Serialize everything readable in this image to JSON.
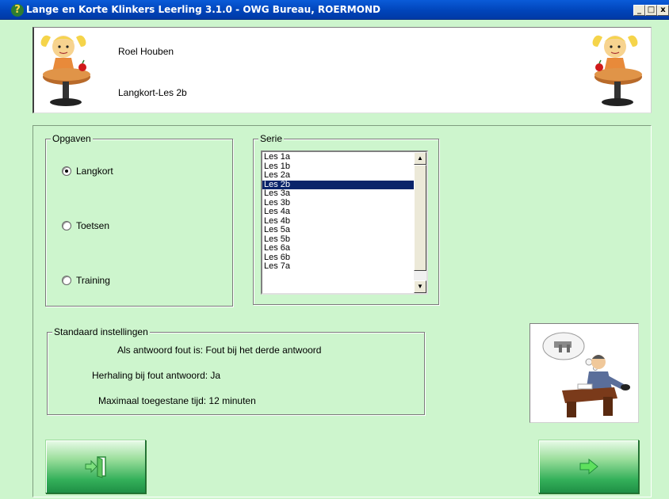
{
  "window": {
    "title": "Lange en Korte Klinkers Leerling  3.1.0 - OWG Bureau, ROERMOND",
    "title_icon": "question-icon",
    "controls": [
      "_",
      "□",
      "x"
    ]
  },
  "header": {
    "student_name": "Roel Houben",
    "lesson_name": "Langkort-Les 2b"
  },
  "opgaven": {
    "legend": "Opgaven",
    "options": [
      {
        "label": "Langkort",
        "selected": true
      },
      {
        "label": "Toetsen",
        "selected": false
      },
      {
        "label": "Training",
        "selected": false
      }
    ]
  },
  "serie": {
    "legend": "Serie",
    "items": [
      "Les 1a",
      "Les 1b",
      "Les 2a",
      "Les 2b",
      "Les 3a",
      "Les 3b",
      "Les 4a",
      "Les 4b",
      "Les 5a",
      "Les 5b",
      "Les 6a",
      "Les 6b",
      "Les 7a"
    ],
    "selected": "Les 2b"
  },
  "standaard": {
    "legend": "Standaard instellingen",
    "line1": "Als antwoord fout is: Fout bij het derde antwoord",
    "line2": "Herhaling bij fout antwoord: Ja",
    "line3": "Maximaal toegestane tijd: 12 minuten"
  },
  "buttons": {
    "exit_icon": "exit-door-icon",
    "next_icon": "arrow-right-icon"
  },
  "colors": {
    "window_bg": "#cdf5cd",
    "titlebar": "#0043b8",
    "selection": "#0a246a",
    "button_green": "#34b05a"
  }
}
